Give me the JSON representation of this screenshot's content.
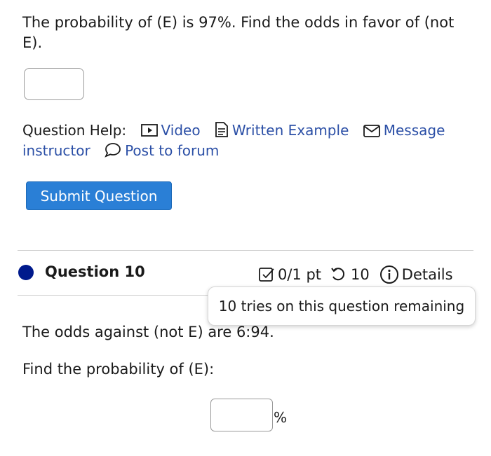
{
  "question9": {
    "text": "The probability of (E) is 97%. Find the odds in favor of (not E).",
    "answer_value": "",
    "help_label": "Question Help:",
    "help_links": {
      "video": "Video",
      "written_example": "Written Example",
      "message_instructor": "Message instructor",
      "post_to_forum": "Post to forum"
    },
    "submit_label": "Submit Question"
  },
  "question10": {
    "title": "Question 10",
    "score": "0/1 pt",
    "tries": "10",
    "details_label": "Details",
    "tooltip": "10 tries on this question remaining",
    "text": "The odds against (not E) are 6:94.",
    "prompt": "Find the probability of (E):",
    "answer_value": "",
    "unit": "%"
  },
  "colors": {
    "link": "#2b4fa6",
    "button": "#2a7fd6",
    "status_dot": "#001a8c"
  }
}
